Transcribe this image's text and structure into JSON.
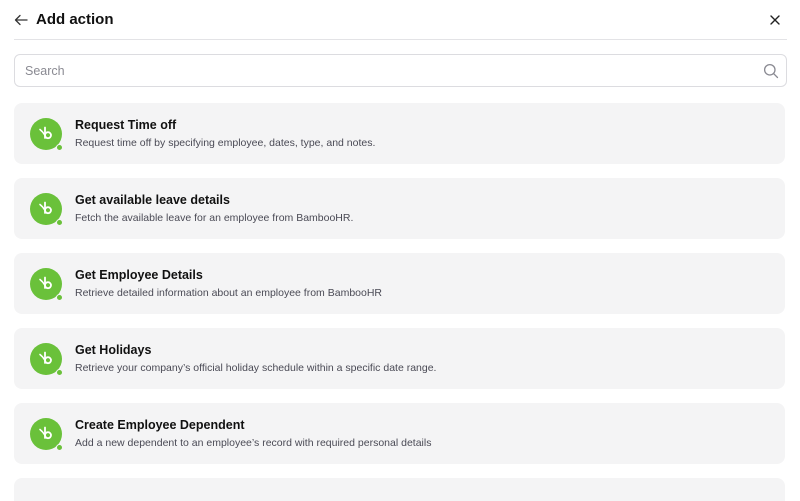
{
  "header": {
    "title": "Add action",
    "back_icon": "arrow-left-icon",
    "close_icon": "close-icon"
  },
  "search": {
    "placeholder": "Search",
    "value": "",
    "icon": "search-icon"
  },
  "actions": [
    {
      "title": "Request Time off",
      "description": "Request time off by specifying employee, dates, type, and notes.",
      "icon": "bamboohr-logo-icon"
    },
    {
      "title": "Get available leave details",
      "description": "Fetch the available leave for an employee from BambooHR.",
      "icon": "bamboohr-logo-icon"
    },
    {
      "title": "Get Employee Details",
      "description": "Retrieve detailed information about an employee from BambooHR",
      "icon": "bamboohr-logo-icon"
    },
    {
      "title": "Get Holidays",
      "description": "Retrieve your company’s official holiday schedule within a specific date range.",
      "icon": "bamboohr-logo-icon"
    },
    {
      "title": "Create Employee Dependent",
      "description": "Add a new dependent to an employee’s record with required personal details",
      "icon": "bamboohr-logo-icon"
    }
  ],
  "colors": {
    "brand_green": "#6ac13a",
    "card_bg": "#f4f4f5",
    "border": "#dcdce0"
  }
}
